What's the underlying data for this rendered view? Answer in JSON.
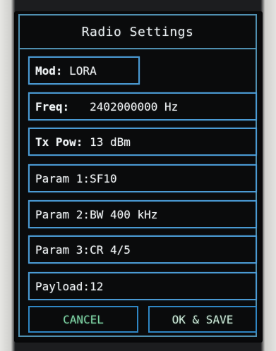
{
  "dialog": {
    "title": "Radio Settings"
  },
  "fields": {
    "mod": {
      "label": "Mod:",
      "value": " LORA"
    },
    "freq": {
      "label": "Freq:",
      "value": "   2402000000 Hz"
    },
    "tx_pow": {
      "label": "Tx Pow:",
      "value": " 13 dBm"
    },
    "param1": {
      "label": "Param 1:",
      "value": "SF10"
    },
    "param2": {
      "label": "Param 2:",
      "value": "BW 400 kHz"
    },
    "param3": {
      "label": "Param 3:",
      "value": "CR 4/5"
    },
    "payload": {
      "label": "Payload:",
      "value": "12"
    }
  },
  "buttons": {
    "cancel": "CANCEL",
    "ok_save": "OK & SAVE"
  },
  "colors": {
    "border": "#4a9ad3",
    "cancel_text": "#7fd4a5",
    "text": "#eef2f4"
  }
}
